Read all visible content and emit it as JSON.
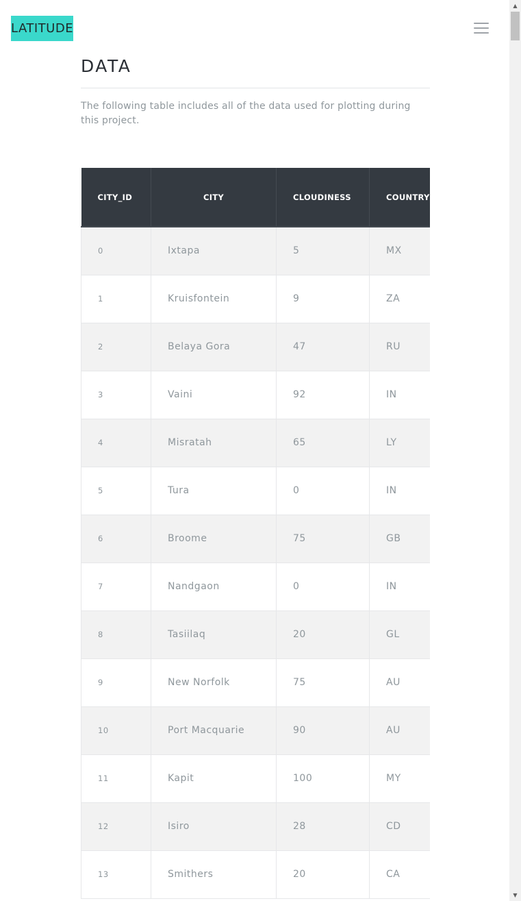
{
  "navbar": {
    "brand": "LATITUDE",
    "menu_icon": "hamburger-icon"
  },
  "content": {
    "title": "DATA",
    "intro": "The following table includes all of the data used for plotting during this project."
  },
  "table": {
    "headers": [
      "CITY_ID",
      "CITY",
      "CLOUDINESS",
      "COUNTRY"
    ],
    "rows": [
      [
        "0",
        "Ixtapa",
        "5",
        "MX"
      ],
      [
        "1",
        "Kruisfontein",
        "9",
        "ZA"
      ],
      [
        "2",
        "Belaya Gora",
        "47",
        "RU"
      ],
      [
        "3",
        "Vaini",
        "92",
        "IN"
      ],
      [
        "4",
        "Misratah",
        "65",
        "LY"
      ],
      [
        "5",
        "Tura",
        "0",
        "IN"
      ],
      [
        "6",
        "Broome",
        "75",
        "GB"
      ],
      [
        "7",
        "Nandgaon",
        "0",
        "IN"
      ],
      [
        "8",
        "Tasiilaq",
        "20",
        "GL"
      ],
      [
        "9",
        "New Norfolk",
        "75",
        "AU"
      ],
      [
        "10",
        "Port Macquarie",
        "90",
        "AU"
      ],
      [
        "11",
        "Kapit",
        "100",
        "MY"
      ],
      [
        "12",
        "Isiro",
        "28",
        "CD"
      ],
      [
        "13",
        "Smithers",
        "20",
        "CA"
      ]
    ]
  },
  "scrollbar": {
    "up_icon": "arrow-up-icon",
    "down_icon": "arrow-down-icon"
  }
}
